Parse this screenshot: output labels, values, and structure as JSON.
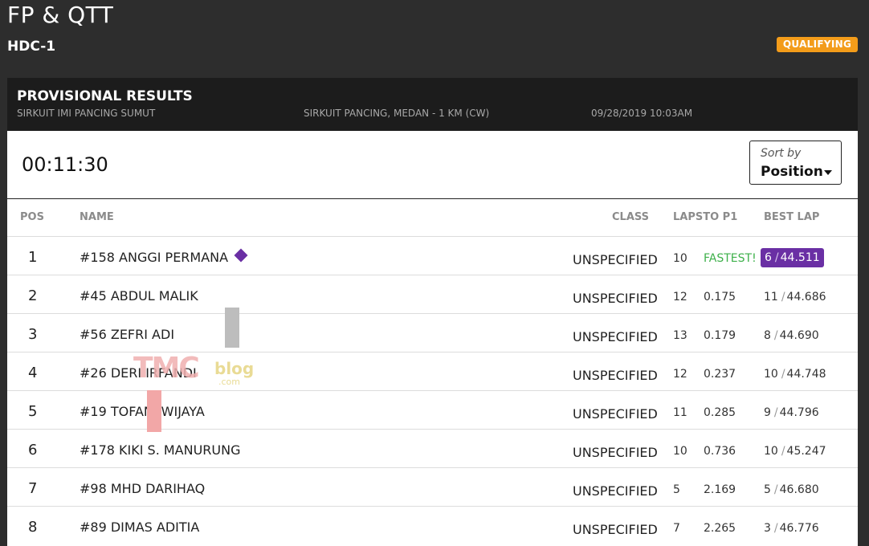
{
  "header": {
    "title": "FP & QTT",
    "event": "HDC-1",
    "session_badge": "QUALIFYING"
  },
  "panel": {
    "title": "PROVISIONAL RESULTS",
    "venue": "SIRKUIT IMI PANCING SUMUT",
    "track": "SIRKUIT PANCING, MEDAN - 1 KM (CW)",
    "datetime": "09/28/2019 10:03AM"
  },
  "timer": "00:11:30",
  "sort": {
    "label": "Sort by",
    "value": "Position"
  },
  "table": {
    "columns": {
      "pos": "POS",
      "name": "NAME",
      "class": "CLASS",
      "laps": "LAPSTO P1",
      "best": "BEST LAP"
    },
    "rows": [
      {
        "pos": "1",
        "name": "#158 ANGGI PERMANA",
        "class": "UNSPECIFIED",
        "laps": "10",
        "gap": "FASTEST!",
        "best_lap_no": "6",
        "best_time": "44.511"
      },
      {
        "pos": "2",
        "name": "#45 ABDUL MALIK",
        "class": "UNSPECIFIED",
        "laps": "12",
        "gap": "0.175",
        "best_lap_no": "11",
        "best_time": "44.686"
      },
      {
        "pos": "3",
        "name": "#56 ZEFRI ADI",
        "class": "UNSPECIFIED",
        "laps": "13",
        "gap": "0.179",
        "best_lap_no": "8",
        "best_time": "44.690"
      },
      {
        "pos": "4",
        "name": "#26 DERI IRFANDI",
        "class": "UNSPECIFIED",
        "laps": "12",
        "gap": "0.237",
        "best_lap_no": "10",
        "best_time": "44.748"
      },
      {
        "pos": "5",
        "name": "#19 TOFANI WIJAYA",
        "class": "UNSPECIFIED",
        "laps": "11",
        "gap": "0.285",
        "best_lap_no": "9",
        "best_time": "44.796"
      },
      {
        "pos": "6",
        "name": "#178 KIKI S. MANURUNG",
        "class": "UNSPECIFIED",
        "laps": "10",
        "gap": "0.736",
        "best_lap_no": "10",
        "best_time": "45.247"
      },
      {
        "pos": "7",
        "name": "#98 MHD DARIHAQ",
        "class": "UNSPECIFIED",
        "laps": "5",
        "gap": "2.169",
        "best_lap_no": "5",
        "best_time": "46.680"
      },
      {
        "pos": "8",
        "name": "#89 DIMAS ADITIA",
        "class": "UNSPECIFIED",
        "laps": "7",
        "gap": "2.265",
        "best_lap_no": "3",
        "best_time": "46.776"
      }
    ]
  },
  "watermark": {
    "brand": "TMC",
    "suffix": "blog",
    "domain": ".com"
  },
  "colors": {
    "background": "#2d2d2d",
    "badge": "#f39c1a",
    "fastest_text": "#3db04a",
    "best_lap_highlight": "#6a2fa4"
  },
  "icons": {
    "fastest_marker": "diamond-icon",
    "sort_caret": "caret-down-icon"
  }
}
